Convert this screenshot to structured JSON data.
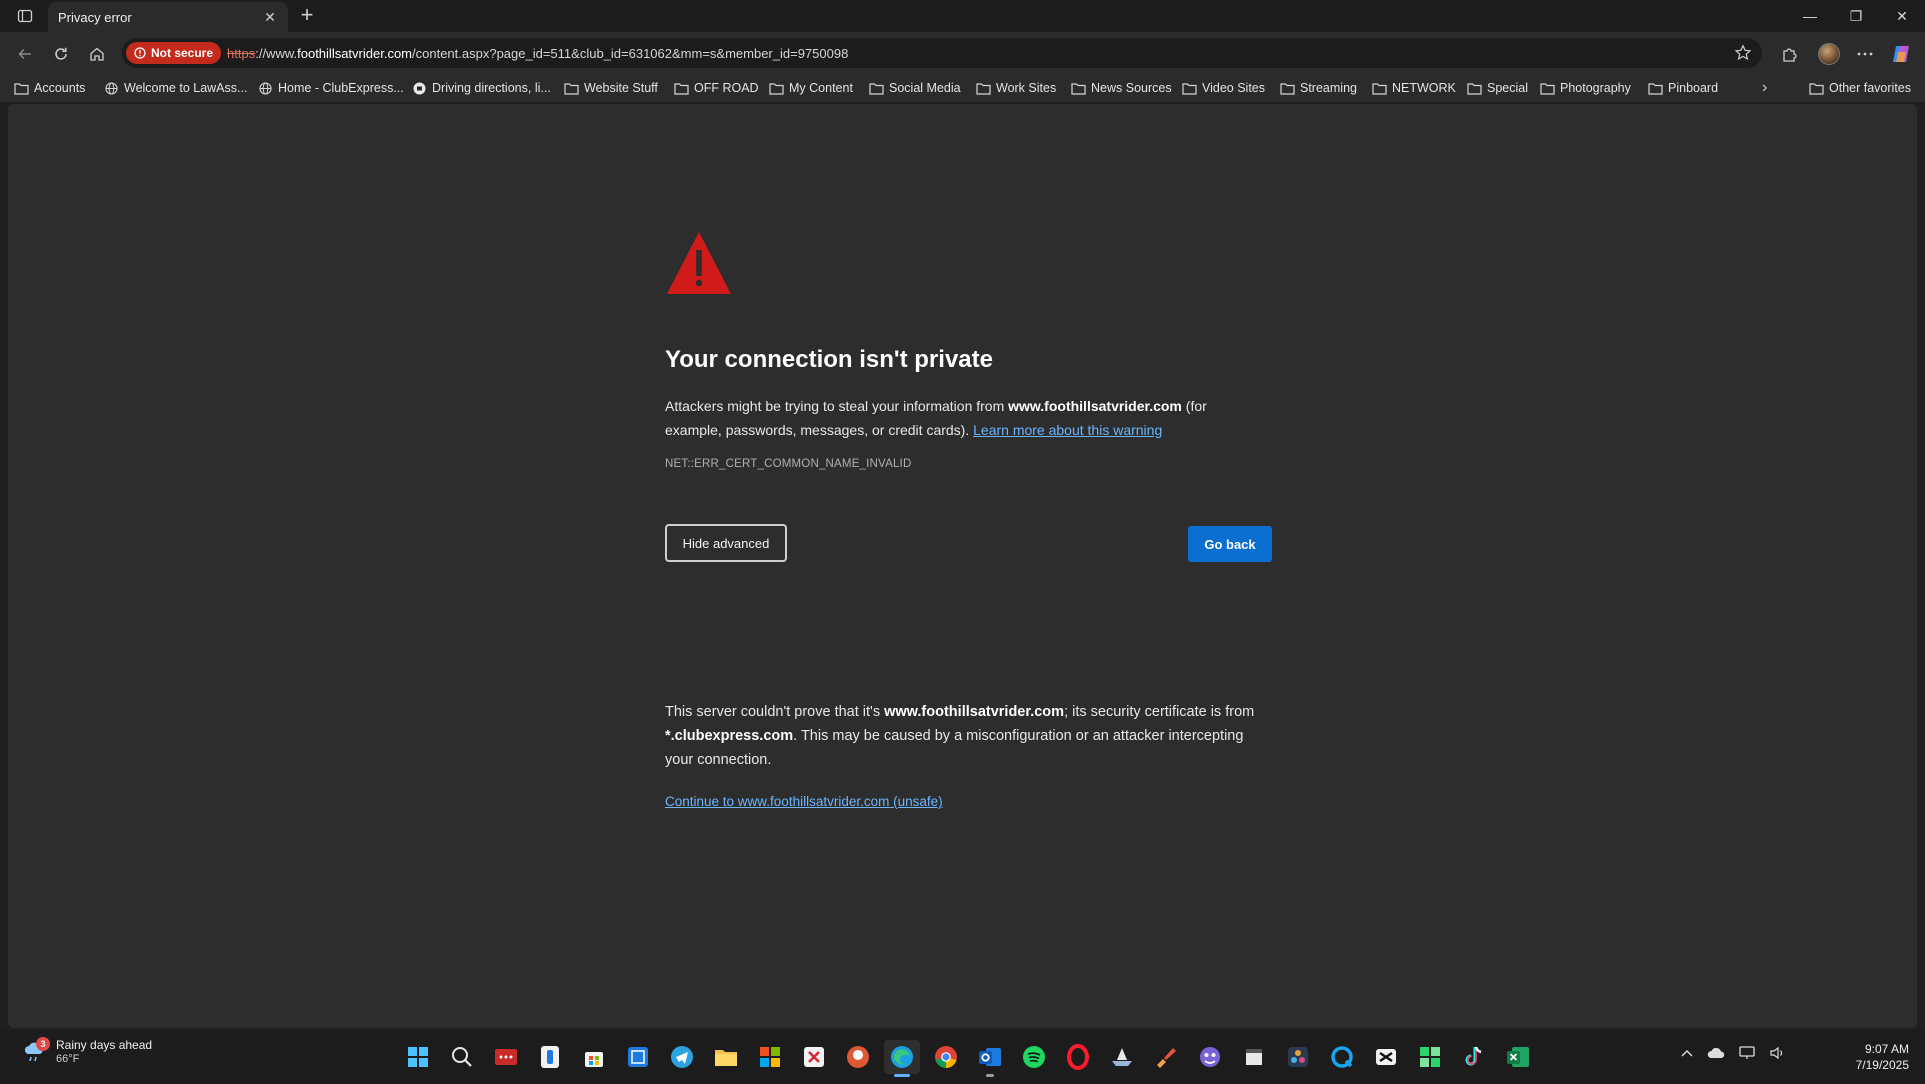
{
  "browser": {
    "tab": {
      "title": "Privacy error",
      "close": "✕"
    },
    "new_tab": "+",
    "window_controls": {
      "minimize": "—",
      "restore": "❐",
      "close": "✕"
    },
    "address": {
      "security_label": "Not secure",
      "url_scheme": "https",
      "url_prefix": "://www.",
      "url_host": "foothillsatvrider.com",
      "url_path": "/content.aspx?page_id=511&club_id=631062&mm=s&member_id=9750098"
    }
  },
  "bookmarks": {
    "items": [
      {
        "label": "Accounts",
        "icon": "folder-icon"
      },
      {
        "label": "Welcome to LawAss...",
        "icon": "globe-icon"
      },
      {
        "label": "Home - ClubExpress...",
        "icon": "globe-icon"
      },
      {
        "label": "Driving directions, li...",
        "icon": "map-icon"
      },
      {
        "label": "Website Stuff",
        "icon": "folder-icon"
      },
      {
        "label": "OFF ROAD",
        "icon": "folder-icon"
      },
      {
        "label": "My Content",
        "icon": "folder-icon"
      },
      {
        "label": "Social Media",
        "icon": "folder-icon"
      },
      {
        "label": "Work Sites",
        "icon": "folder-icon"
      },
      {
        "label": "News Sources",
        "icon": "folder-icon"
      },
      {
        "label": "Video Sites",
        "icon": "folder-icon"
      },
      {
        "label": "Streaming",
        "icon": "folder-icon"
      },
      {
        "label": "NETWORK",
        "icon": "folder-icon"
      },
      {
        "label": "Special",
        "icon": "folder-icon"
      },
      {
        "label": "Photography",
        "icon": "folder-icon"
      },
      {
        "label": "Pinboard",
        "icon": "folder-icon"
      }
    ],
    "overflow": "›",
    "other": "Other favorites"
  },
  "error": {
    "title": "Your connection isn't private",
    "desc_before": "Attackers might be trying to steal your information from ",
    "desc_host": "www.foothillsatvrider.com",
    "desc_after": " (for example, passwords, messages, or credit cards). ",
    "learn_more": "Learn more about this warning",
    "code": "NET::ERR_CERT_COMMON_NAME_INVALID",
    "hide_advanced": "Hide advanced",
    "go_back": "Go back",
    "detail_1": "This server couldn't prove that it's ",
    "detail_host": "www.foothillsatvrider.com",
    "detail_2": "; its security certificate is from ",
    "detail_cert": "*.clubexpress.com",
    "detail_3": ". This may be caused by a misconfiguration or an attacker intercepting your connection.",
    "continue_link": "Continue to www.foothillsatvrider.com (unsafe)"
  },
  "colors": {
    "accent": "#0a6fd0",
    "link": "#6cb6ff",
    "danger": "#c42b1c",
    "warning_red": "#d11a1a"
  },
  "taskbar": {
    "weather": {
      "badge": "3",
      "text": "Rainy days ahead",
      "temp": "66°F"
    },
    "apps": [
      "windows-start-icon",
      "search-icon",
      "dots-app-icon",
      "keyboard-app-icon",
      "store-icon",
      "calculator-icon",
      "telegram-icon",
      "file-explorer-icon",
      "microsoft-icon",
      "snip-icon",
      "duckduckgo-icon",
      "edge-icon",
      "chrome-icon",
      "outlook-icon",
      "spotify-icon",
      "opera-icon",
      "ship-app-icon",
      "brush-app-icon",
      "copilot-icon",
      "clapper-icon",
      "davinci-icon",
      "q-app-icon",
      "capcut-icon",
      "green-app-icon",
      "tiktok-icon",
      "excel-icon"
    ],
    "clock": {
      "time": "9:07 AM",
      "date": "7/19/2025"
    }
  }
}
